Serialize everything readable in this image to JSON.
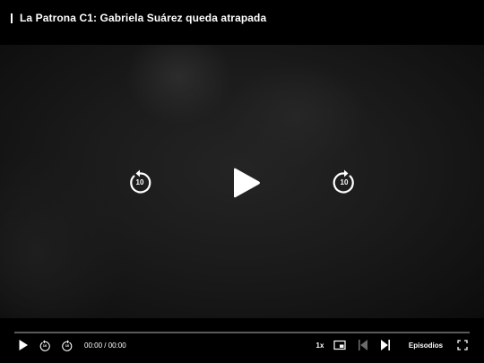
{
  "player": {
    "title": "La Patrona C1: Gabriela Suárez queda atrapada",
    "skip_seconds_label": "10",
    "time_display": "00:00 / 00:00",
    "speed_label": "1x",
    "episodes_label": "Episodios",
    "progress_fraction": 0,
    "accent_color": "#e50914",
    "icons": {
      "back": "back-bar-icon",
      "play": "play-icon",
      "rewind": "rewind-10-icon",
      "forward": "forward-10-icon",
      "pip": "picture-in-picture-icon",
      "previous": "previous-episode-icon",
      "next": "next-episode-icon",
      "fullscreen": "fullscreen-icon"
    }
  }
}
